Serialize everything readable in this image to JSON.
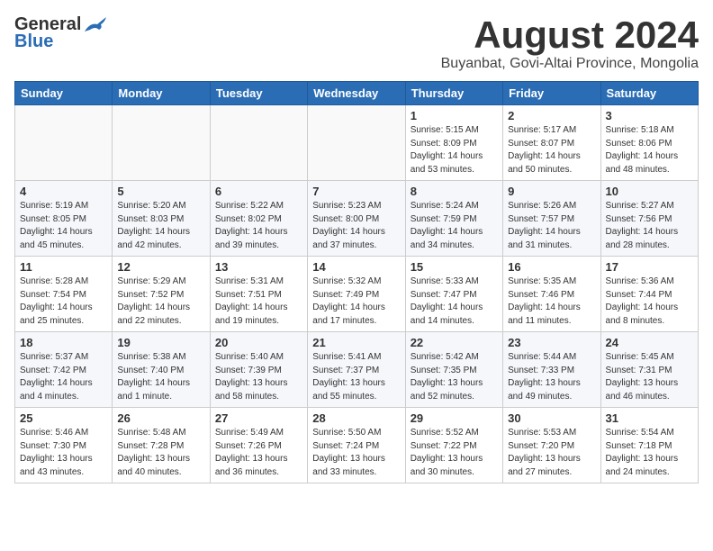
{
  "header": {
    "logo_general": "General",
    "logo_blue": "Blue",
    "month_title": "August 2024",
    "location": "Buyanbat, Govi-Altai Province, Mongolia"
  },
  "days_of_week": [
    "Sunday",
    "Monday",
    "Tuesday",
    "Wednesday",
    "Thursday",
    "Friday",
    "Saturday"
  ],
  "weeks": [
    [
      {
        "day": "",
        "info": ""
      },
      {
        "day": "",
        "info": ""
      },
      {
        "day": "",
        "info": ""
      },
      {
        "day": "",
        "info": ""
      },
      {
        "day": "1",
        "info": "Sunrise: 5:15 AM\nSunset: 8:09 PM\nDaylight: 14 hours\nand 53 minutes."
      },
      {
        "day": "2",
        "info": "Sunrise: 5:17 AM\nSunset: 8:07 PM\nDaylight: 14 hours\nand 50 minutes."
      },
      {
        "day": "3",
        "info": "Sunrise: 5:18 AM\nSunset: 8:06 PM\nDaylight: 14 hours\nand 48 minutes."
      }
    ],
    [
      {
        "day": "4",
        "info": "Sunrise: 5:19 AM\nSunset: 8:05 PM\nDaylight: 14 hours\nand 45 minutes."
      },
      {
        "day": "5",
        "info": "Sunrise: 5:20 AM\nSunset: 8:03 PM\nDaylight: 14 hours\nand 42 minutes."
      },
      {
        "day": "6",
        "info": "Sunrise: 5:22 AM\nSunset: 8:02 PM\nDaylight: 14 hours\nand 39 minutes."
      },
      {
        "day": "7",
        "info": "Sunrise: 5:23 AM\nSunset: 8:00 PM\nDaylight: 14 hours\nand 37 minutes."
      },
      {
        "day": "8",
        "info": "Sunrise: 5:24 AM\nSunset: 7:59 PM\nDaylight: 14 hours\nand 34 minutes."
      },
      {
        "day": "9",
        "info": "Sunrise: 5:26 AM\nSunset: 7:57 PM\nDaylight: 14 hours\nand 31 minutes."
      },
      {
        "day": "10",
        "info": "Sunrise: 5:27 AM\nSunset: 7:56 PM\nDaylight: 14 hours\nand 28 minutes."
      }
    ],
    [
      {
        "day": "11",
        "info": "Sunrise: 5:28 AM\nSunset: 7:54 PM\nDaylight: 14 hours\nand 25 minutes."
      },
      {
        "day": "12",
        "info": "Sunrise: 5:29 AM\nSunset: 7:52 PM\nDaylight: 14 hours\nand 22 minutes."
      },
      {
        "day": "13",
        "info": "Sunrise: 5:31 AM\nSunset: 7:51 PM\nDaylight: 14 hours\nand 19 minutes."
      },
      {
        "day": "14",
        "info": "Sunrise: 5:32 AM\nSunset: 7:49 PM\nDaylight: 14 hours\nand 17 minutes."
      },
      {
        "day": "15",
        "info": "Sunrise: 5:33 AM\nSunset: 7:47 PM\nDaylight: 14 hours\nand 14 minutes."
      },
      {
        "day": "16",
        "info": "Sunrise: 5:35 AM\nSunset: 7:46 PM\nDaylight: 14 hours\nand 11 minutes."
      },
      {
        "day": "17",
        "info": "Sunrise: 5:36 AM\nSunset: 7:44 PM\nDaylight: 14 hours\nand 8 minutes."
      }
    ],
    [
      {
        "day": "18",
        "info": "Sunrise: 5:37 AM\nSunset: 7:42 PM\nDaylight: 14 hours\nand 4 minutes."
      },
      {
        "day": "19",
        "info": "Sunrise: 5:38 AM\nSunset: 7:40 PM\nDaylight: 14 hours\nand 1 minute."
      },
      {
        "day": "20",
        "info": "Sunrise: 5:40 AM\nSunset: 7:39 PM\nDaylight: 13 hours\nand 58 minutes."
      },
      {
        "day": "21",
        "info": "Sunrise: 5:41 AM\nSunset: 7:37 PM\nDaylight: 13 hours\nand 55 minutes."
      },
      {
        "day": "22",
        "info": "Sunrise: 5:42 AM\nSunset: 7:35 PM\nDaylight: 13 hours\nand 52 minutes."
      },
      {
        "day": "23",
        "info": "Sunrise: 5:44 AM\nSunset: 7:33 PM\nDaylight: 13 hours\nand 49 minutes."
      },
      {
        "day": "24",
        "info": "Sunrise: 5:45 AM\nSunset: 7:31 PM\nDaylight: 13 hours\nand 46 minutes."
      }
    ],
    [
      {
        "day": "25",
        "info": "Sunrise: 5:46 AM\nSunset: 7:30 PM\nDaylight: 13 hours\nand 43 minutes."
      },
      {
        "day": "26",
        "info": "Sunrise: 5:48 AM\nSunset: 7:28 PM\nDaylight: 13 hours\nand 40 minutes."
      },
      {
        "day": "27",
        "info": "Sunrise: 5:49 AM\nSunset: 7:26 PM\nDaylight: 13 hours\nand 36 minutes."
      },
      {
        "day": "28",
        "info": "Sunrise: 5:50 AM\nSunset: 7:24 PM\nDaylight: 13 hours\nand 33 minutes."
      },
      {
        "day": "29",
        "info": "Sunrise: 5:52 AM\nSunset: 7:22 PM\nDaylight: 13 hours\nand 30 minutes."
      },
      {
        "day": "30",
        "info": "Sunrise: 5:53 AM\nSunset: 7:20 PM\nDaylight: 13 hours\nand 27 minutes."
      },
      {
        "day": "31",
        "info": "Sunrise: 5:54 AM\nSunset: 7:18 PM\nDaylight: 13 hours\nand 24 minutes."
      }
    ]
  ]
}
